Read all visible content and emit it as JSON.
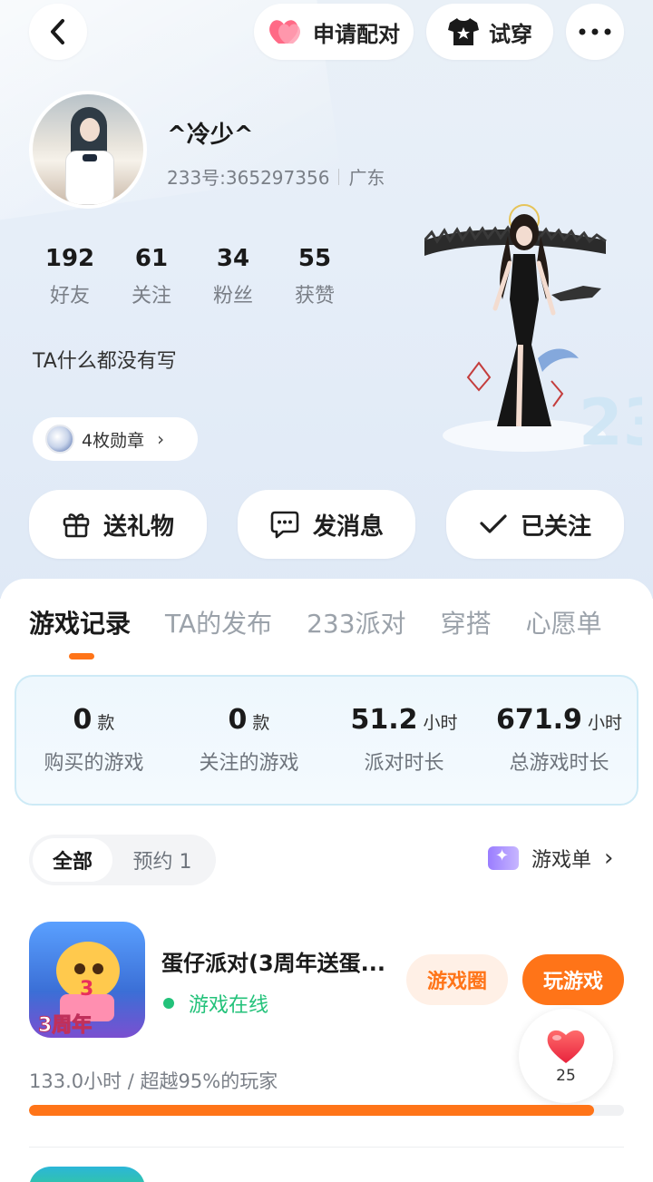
{
  "header": {
    "pair_label": "申请配对",
    "try_label": "试穿"
  },
  "profile": {
    "username": "^冷少^",
    "id_text": "233号:365297356",
    "location": "广东",
    "stats": [
      {
        "value": "192",
        "label": "好友"
      },
      {
        "value": "61",
        "label": "关注"
      },
      {
        "value": "34",
        "label": "粉丝"
      },
      {
        "value": "55",
        "label": "获赞"
      }
    ],
    "bio": "TA什么都没有写",
    "medals_label": "4枚勋章"
  },
  "actions": {
    "gift": "送礼物",
    "message": "发消息",
    "followed": "已关注"
  },
  "tabs": [
    "游戏记录",
    "TA的发布",
    "233派对",
    "穿搭",
    "心愿单"
  ],
  "summary": [
    {
      "value": "0",
      "unit": "款",
      "label": "购买的游戏"
    },
    {
      "value": "0",
      "unit": "款",
      "label": "关注的游戏"
    },
    {
      "value": "51.2",
      "unit": "小时",
      "label": "派对时长"
    },
    {
      "value": "671.9",
      "unit": "小时",
      "label": "总游戏时长"
    }
  ],
  "filters": {
    "all": "全部",
    "reserved": "预约 1",
    "game_list": "游戏单"
  },
  "game": {
    "name": "蛋仔派对(3周年送蛋...",
    "icon_text": "3周年",
    "icon_number": "3",
    "status": "游戏在线",
    "circle_label": "游戏圈",
    "play_label": "玩游戏",
    "play_time": "133.0小时 / 超越95%的玩家",
    "progress_fraction": 0.95
  },
  "like": {
    "count": "25"
  },
  "colors": {
    "accent": "#ff7418",
    "online": "#23c27a"
  }
}
